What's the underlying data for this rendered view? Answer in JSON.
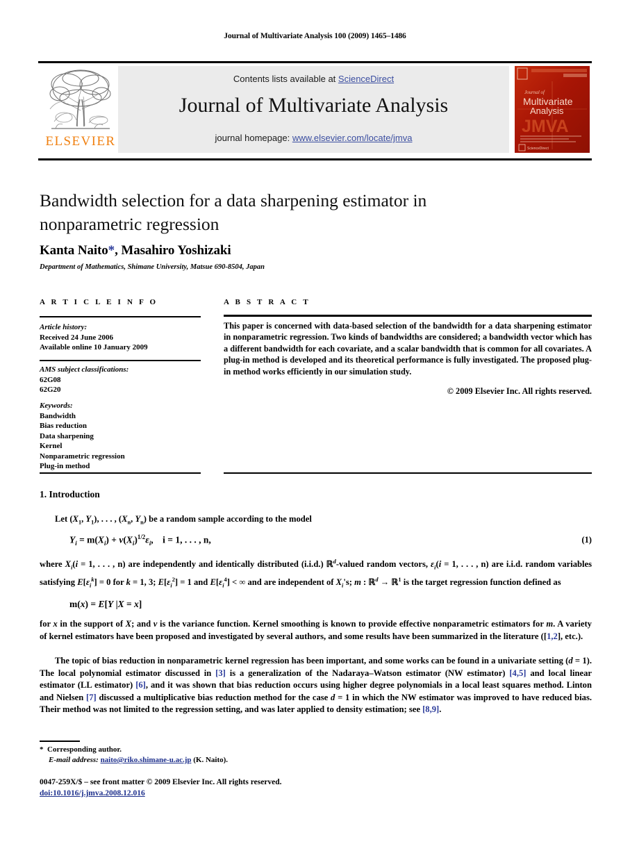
{
  "running_head": "Journal of Multivariate Analysis 100 (2009) 1465–1486",
  "masthead": {
    "contents_prefix": "Contents lists available at ",
    "sciencedirect": "ScienceDirect",
    "journal_name": "Journal of Multivariate Analysis",
    "homepage_prefix": "journal homepage: ",
    "homepage_url": "www.elsevier.com/locate/jmva",
    "publisher_logo_text": "ELSEVIER",
    "publisher_logo_color": "#f08010",
    "link_color": "#3b4ea0",
    "box_color": "#ebebeb",
    "cover": {
      "line1": "Journal of",
      "line2": "Multivariate",
      "line3": "Analysis",
      "acronym": "JMVA",
      "footer": "ScienceDirect",
      "color": "#b01808"
    }
  },
  "article": {
    "title": "Bandwidth selection for a data sharpening estimator in nonparametric regression",
    "authors": "Kanta Naito*, Masahiro Yoshizaki",
    "authors_plain": "Kanta Naito",
    "authors_rest": ", Masahiro Yoshizaki",
    "affiliation": "Department of Mathematics, Shimane University, Matsue 690-8504, Japan"
  },
  "info": {
    "heading": "A R T I C L E    I N F O",
    "history_label": "Article history:",
    "history": [
      "Received 24 June 2006",
      "Available online 10 January 2009"
    ],
    "ams_label": "AMS subject classifications:",
    "ams": [
      "62G08",
      "62G20"
    ],
    "keywords_label": "Keywords:",
    "keywords": [
      "Bandwidth",
      "Bias reduction",
      "Data sharpening",
      "Kernel",
      "Nonparametric regression",
      "Plug-in method"
    ]
  },
  "abstract": {
    "heading": "A B S T R A C T",
    "text": "This paper is concerned with data-based selection of the bandwidth for a data sharpening estimator in nonparametric regression. Two kinds of bandwidths are considered; a bandwidth vector which has a different bandwidth for each covariate, and a scalar bandwidth that is common for all covariates. A plug-in method is developed and its theoretical performance is fully investigated. The proposed plug-in method works efficiently in our simulation study.",
    "copyright": "© 2009 Elsevier Inc. All rights reserved."
  },
  "body": {
    "section_title": "1. Introduction",
    "p1": "Let (X₁, Y₁), . . . , (Xₙ, Yₙ) be a random sample according to the model",
    "equation1_number": "(1)",
    "p2_a": "where ",
    "p2_b": "(i = 1, . . . , n) are independently and identically distributed (i.i.d.) ",
    "p2_c": "-valued random vectors, ",
    "p2_d": "(i = 1, . . . , n) are i.i.d. random variables satisfying ",
    "p2_e": " is the target regression function defined as",
    "p3": "for x in the support of X; and v is the variance function. Kernel smoothing is known to provide effective nonparametric estimators for m. A variety of kernel estimators have been proposed and investigated by several authors, and some results have been summarized in the literature ([1,2], etc.).",
    "p4_pre": "The topic of bias reduction in nonparametric kernel regression has been important, and some works can be found in a univariate setting (d = 1). The local polynomial estimator discussed in ",
    "p4_cite1": "[3]",
    "p4_mid1": " is a generalization of the Nadaraya–Watson estimator (NW estimator) ",
    "p4_cite2": "[4,5]",
    "p4_mid2": " and local linear estimator (LL estimator) ",
    "p4_cite3": "[6]",
    "p4_mid3": ", and it was shown that bias reduction occurs using higher degree polynomials in a local least squares method. Linton and Nielsen ",
    "p4_cite4": "[7]",
    "p4_mid4": " discussed a multiplicative bias reduction method for the case d = 1 in which the NW estimator was improved to have reduced bias. Their method was not limited to the regression setting, and was later applied to density estimation; see ",
    "p4_cite5": "[8,9]",
    "p4_end": "."
  },
  "footer": {
    "corresponding_marker": "*",
    "corresponding_text": "Corresponding author.",
    "email_label": "E-mail address:",
    "email": "naito@riko.shimane-u.ac.jp",
    "email_owner": "(K. Naito).",
    "frontmatter": "0047-259X/$ – see front matter © 2009 Elsevier Inc. All rights reserved.",
    "doi": "doi:10.1016/j.jmva.2008.12.016"
  }
}
